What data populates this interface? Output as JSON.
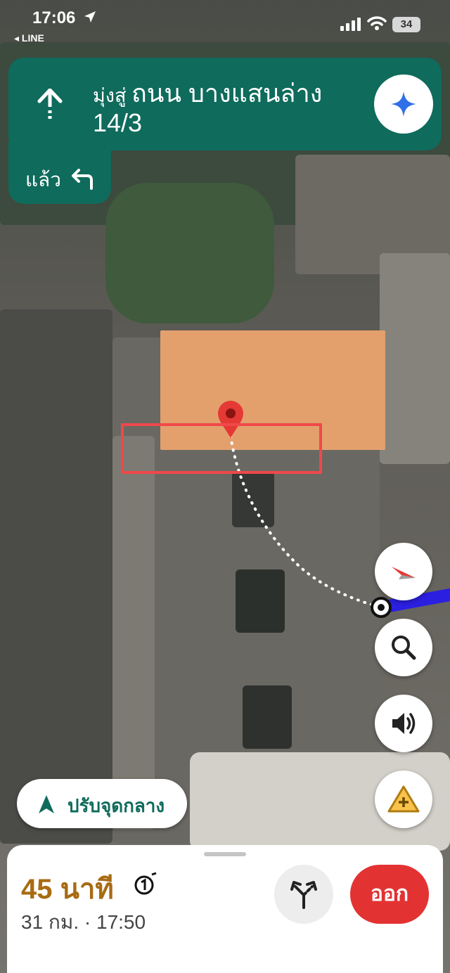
{
  "status_bar": {
    "time": "17:06",
    "back_app": "◂ LINE",
    "battery": "34"
  },
  "navigation": {
    "toward_prefix": "มุ่งสู่",
    "road": "ถนน บางแสนล่าง",
    "address": "14/3",
    "then_label": "แล้ว",
    "banner_color": "#0f6b5c"
  },
  "recenter": {
    "label": "ปรับจุดกลาง"
  },
  "trip": {
    "eta_value": "45",
    "eta_unit": "นาที",
    "arrival": "31 กม. · 17:50",
    "exit_label": "ออก",
    "eta_color": "#a86b12",
    "exit_color": "#e33232"
  },
  "route": {
    "route_color": "#2b1fe0",
    "pin_color": "#e53935",
    "highlight_color": "#f0484a"
  },
  "icons": {
    "turn": "arrow-up-icon",
    "then": "turn-left-icon",
    "gemini": "sparkle-icon",
    "compass": "compass-icon",
    "search": "search-icon",
    "sound": "speaker-icon",
    "report": "report-incident-icon",
    "recenter": "navigation-arrow-icon",
    "alternate": "alternate-route-icon",
    "route_option": "circled-one-icon"
  }
}
